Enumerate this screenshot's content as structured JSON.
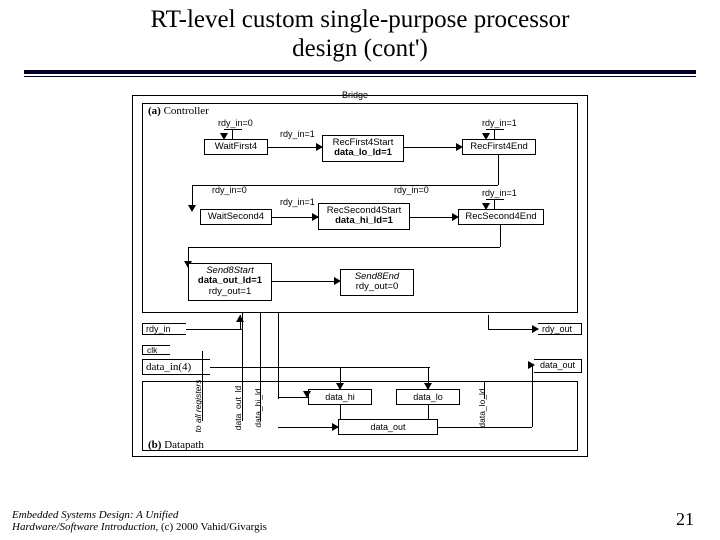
{
  "title_line1": "RT-level custom single-purpose processor",
  "title_line2": "design (cont')",
  "outer_label": "Bridge",
  "controller_label": "(a) Controller",
  "datapath_label": "(b) Datapath",
  "edges": {
    "rdy_in0_a": "rdy_in=0",
    "rdy_in1_a": "rdy_in=1",
    "rdy_in1_b": "rdy_in=1",
    "rdy_in0_b": "rdy_in=0",
    "rdy_in1_c": "rdy_in=1",
    "rdy_in0_c": "rdy_in=0",
    "rdy_in1_d": "rdy_in=1"
  },
  "states": {
    "waitFirst4": "WaitFirst4",
    "recFirst4Start_name": "RecFirst4Start",
    "recFirst4Start_act": "data_lo_ld=1",
    "recFirst4End": "RecFirst4End",
    "waitSecond4": "WaitSecond4",
    "recSecond4Start_name": "RecSecond4Start",
    "recSecond4Start_act": "data_hi_ld=1",
    "recSecond4End": "RecSecond4End",
    "send8Start_name": "Send8Start",
    "send8Start_act1": "data_out_ld=1",
    "send8Start_act2": "rdy_out=1",
    "send8End_name": "Send8End",
    "send8End_act": "rdy_out=0"
  },
  "signals": {
    "rdy_in": "rdy_in",
    "rdy_out": "rdy_out",
    "clk": "clk",
    "data_in4": "data_in(4)",
    "data_out": "data_out",
    "to_all_regs": "to all registers",
    "data_out_ld": "data_out_ld",
    "data_hi_ld": "data_hi_ld",
    "data_lo_ld": "data_lo_ld",
    "data_hi": "data_hi",
    "data_lo": "data_lo",
    "data_out_reg": "data_out"
  },
  "footer_line1": "Embedded Systems Design: A Unified",
  "footer_line2_ital": "Hardware/Software Introduction,",
  "footer_line2_plain": " (c) 2000 Vahid/Givargis",
  "page_number": "21"
}
